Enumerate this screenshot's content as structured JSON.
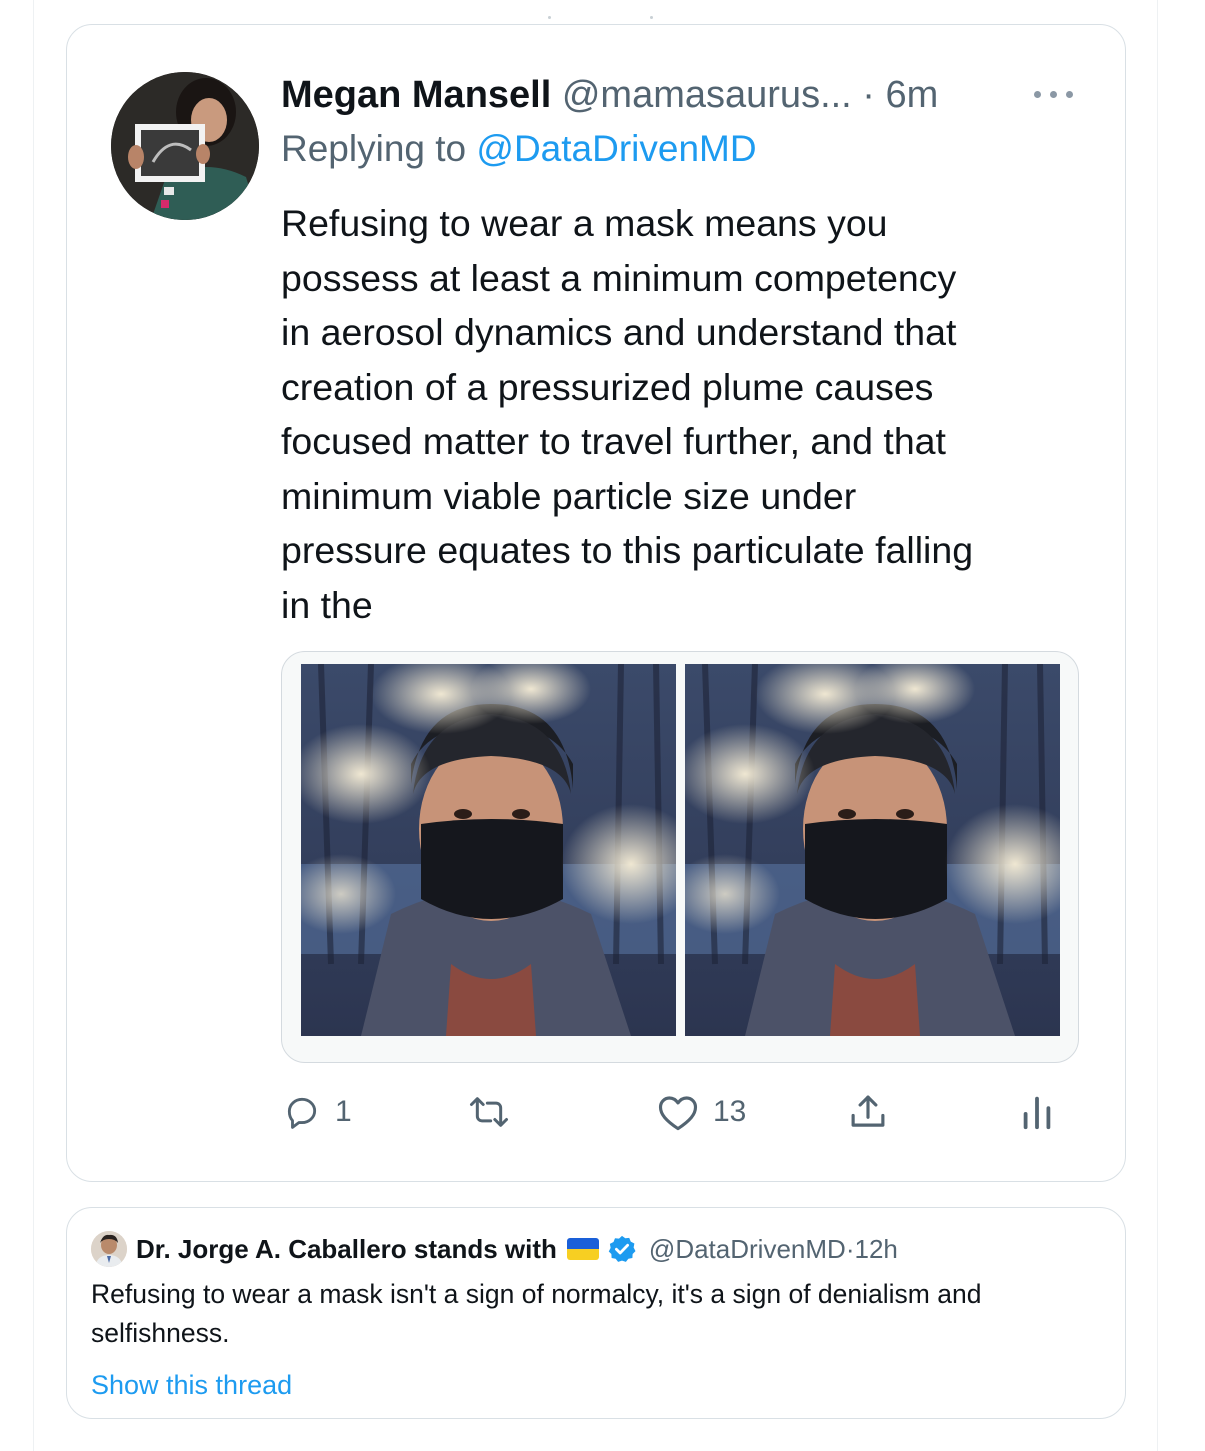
{
  "tweet": {
    "author_name": "Megan Mansell",
    "author_handle": "@mamasaurus...",
    "separator": " · ",
    "time": "6m",
    "reply_prefix": "Replying to ",
    "reply_to": "@DataDrivenMD",
    "text": "Refusing to wear a mask means you\npossess at least a minimum competency\nin aerosol dynamics and understand that\ncreation of a pressurized plume causes\nfocused matter to travel further, and that\nminimum viable particle size under\npressure equates to this particulate falling\nin the",
    "actions": {
      "reply_count": "1",
      "retweet_count": "",
      "like_count": "13"
    },
    "icons": [
      "reply-icon",
      "retweet-icon",
      "like-icon",
      "share-icon",
      "analytics-icon",
      "more-icon"
    ]
  },
  "quoted_tweet": {
    "author_name": "Dr. Jorge A. Caballero stands with",
    "handle": "@DataDrivenMD",
    "separator": " · ",
    "time": "12h",
    "text": "Refusing to wear a mask isn't a sign of normalcy, it's a sign of denialism and selfishness.",
    "show_thread": "Show this thread",
    "flag_colors": [
      "#1a5fd8",
      "#f7cf22"
    ],
    "verified_color": "#1d9bf0"
  },
  "colors": {
    "accent": "#1d9bf0",
    "text_primary": "#0f1419",
    "text_secondary": "#536471",
    "border": "#d9e0e5"
  }
}
